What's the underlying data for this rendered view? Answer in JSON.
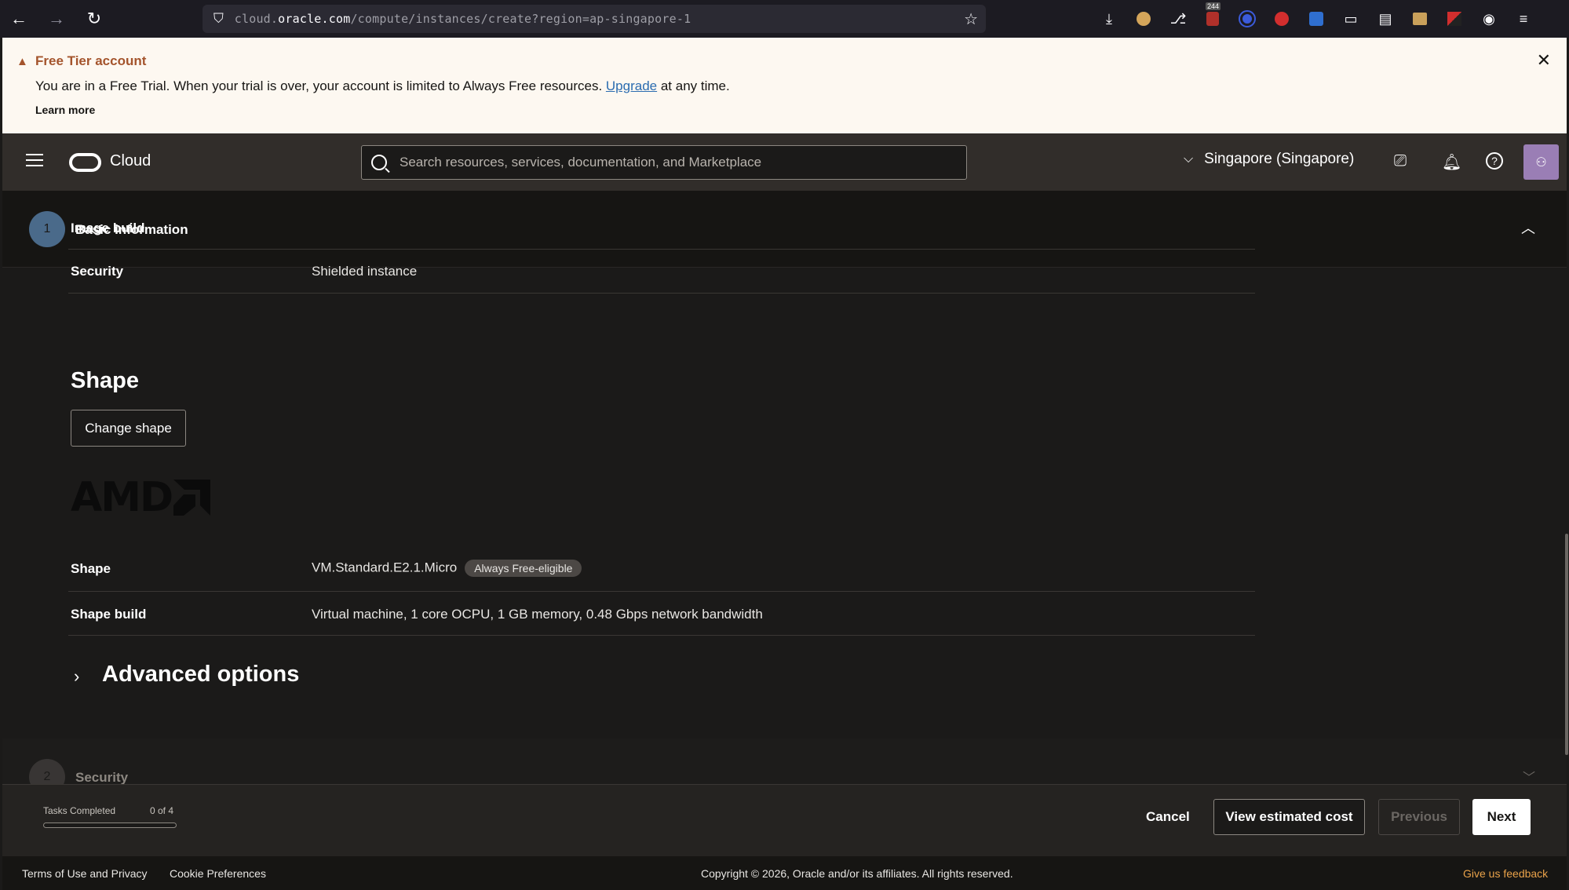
{
  "browser": {
    "url_prefix": "cloud.",
    "url_domain": "oracle.com",
    "url_path": "/compute/instances/create?region=ap-singapore-1",
    "ext_badge": "244"
  },
  "banner": {
    "title": "Free Tier account",
    "text_before": "You are in a Free Trial. When your trial is over, your account is limited to Always Free resources. ",
    "upgrade_link": "Upgrade",
    "text_after": " at any time.",
    "learn_more": "Learn more"
  },
  "header": {
    "brand": "Cloud",
    "search_placeholder": "Search resources, services, documentation, and Marketplace",
    "region": "Singapore (Singapore)"
  },
  "step1": {
    "number": "1",
    "title": "Basic information"
  },
  "main": {
    "image_build_label": "Image build",
    "security_label": "Security",
    "security_value": "Shielded instance",
    "shape_heading": "Shape",
    "change_shape_button": "Change shape",
    "amd_logo_text": "AMD",
    "shape_label": "Shape",
    "shape_value": "VM.Standard.E2.1.Micro",
    "free_badge": "Always Free-eligible",
    "shape_build_label": "Shape build",
    "shape_build_value": "Virtual machine, 1 core OCPU, 1 GB memory, 0.48 Gbps network bandwidth",
    "advanced_options": "Advanced options"
  },
  "step2": {
    "number": "2",
    "title": "Security"
  },
  "action_bar": {
    "tasks_label": "Tasks Completed",
    "tasks_count": "0 of 4",
    "tasks_progress": 0,
    "cancel": "Cancel",
    "view_cost": "View estimated cost",
    "previous": "Previous",
    "next": "Next"
  },
  "footer": {
    "terms": "Terms of Use and Privacy",
    "cookies": "Cookie Preferences",
    "copyright": "Copyright © 2026, Oracle and/or its affiliates. All rights reserved.",
    "feedback": "Give us feedback"
  },
  "colors": {
    "accent_warning": "#a4542c",
    "feedback": "#e9a24a",
    "header_bg": "#312d2a"
  }
}
